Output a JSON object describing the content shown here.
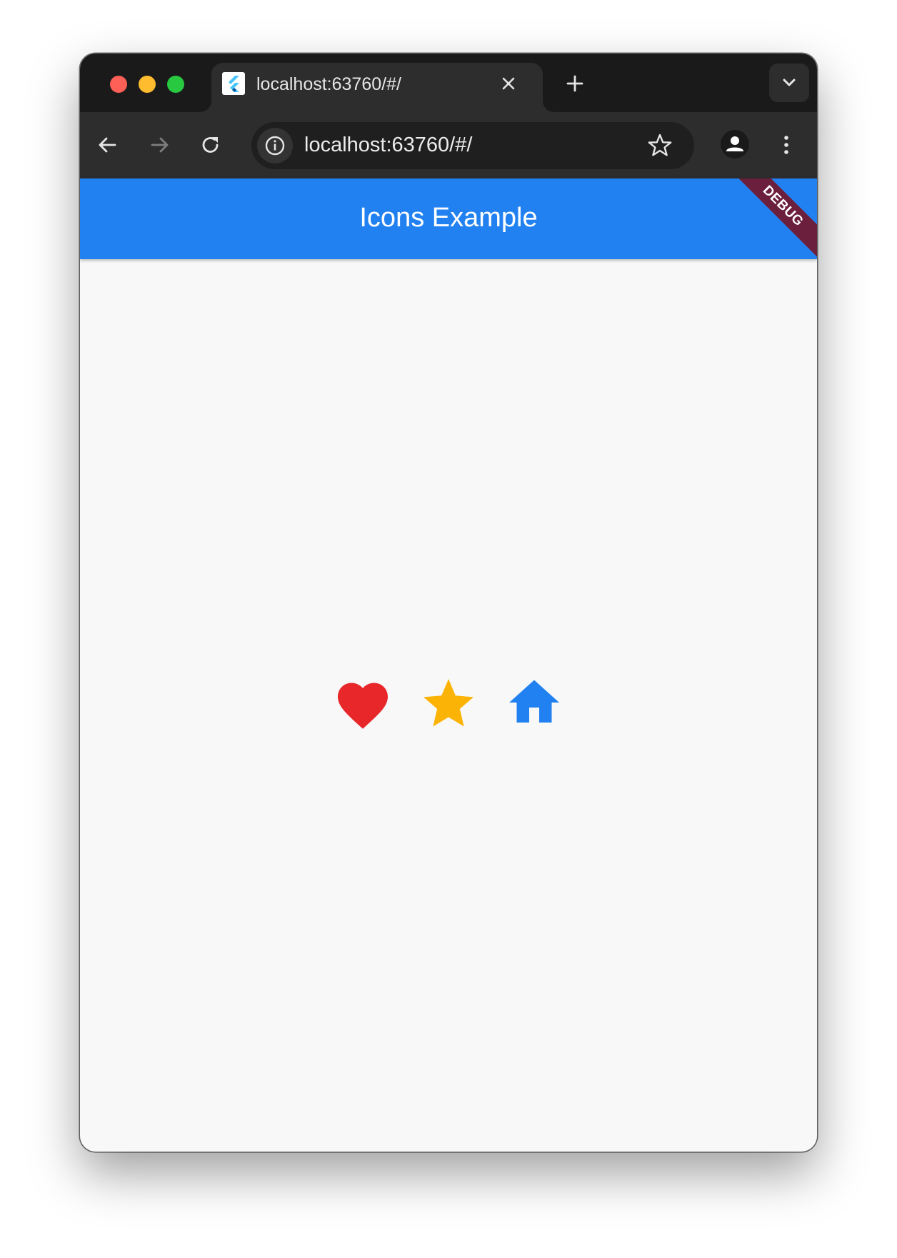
{
  "browser": {
    "tab_title": "localhost:63760/#/",
    "url": "localhost:63760/#/"
  },
  "app": {
    "title": "Icons Example",
    "debug_label": "DEBUG",
    "accent_color": "#2281f0",
    "icons": [
      {
        "name": "heart-icon",
        "color": "#e8272a"
      },
      {
        "name": "star-icon",
        "color": "#fbb306"
      },
      {
        "name": "home-icon",
        "color": "#2281f0"
      }
    ]
  }
}
